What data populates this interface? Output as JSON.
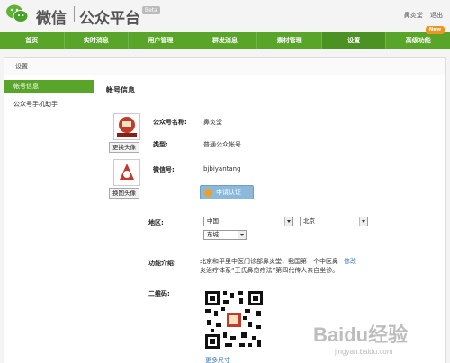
{
  "header": {
    "logo_text": "微信",
    "logo_sub": "公众平台",
    "beta": "Beta",
    "username": "鼻炎堂",
    "logout": "退出"
  },
  "nav": {
    "items": [
      {
        "label": "首页"
      },
      {
        "label": "实时消息"
      },
      {
        "label": "用户管理"
      },
      {
        "label": "群发消息"
      },
      {
        "label": "素材管理"
      },
      {
        "label": "设置"
      },
      {
        "label": "高级功能"
      }
    ],
    "new_badge": "New"
  },
  "breadcrumb": "设置",
  "sidebar": {
    "items": [
      {
        "label": "帐号信息"
      },
      {
        "label": "公众号手机助手"
      }
    ]
  },
  "main": {
    "title": "帐号信息",
    "change_avatar": "更换头像",
    "change_image": "换图头像",
    "rows": {
      "name_label": "公众号名称:",
      "name_value": "鼻炎堂",
      "type_label": "类型:",
      "type_value": "普通公众帐号",
      "wechat_label": "微信号:",
      "wechat_value": "bjbiyantang",
      "verify_button": "申请认证",
      "region_label": "地区:",
      "region_country": "中国",
      "region_province": "北京",
      "region_district": "东城",
      "intro_label": "功能介绍:",
      "intro_value": "北京和平里中医门诊部鼻炎堂，我国第一个中医鼻炎治疗体系“王氏鼻愈疗法”第四代传人亲自坐诊。",
      "intro_edit": "修改",
      "qr_label": "二维码:",
      "qr_link": "更多尺寸"
    }
  },
  "watermark": "Baidu经验",
  "watermark_sub": "jingyan.baidu.com",
  "colors": {
    "nav_green": "#58a52a",
    "link_blue": "#3a77b8",
    "badge_orange": "#f0941f"
  }
}
